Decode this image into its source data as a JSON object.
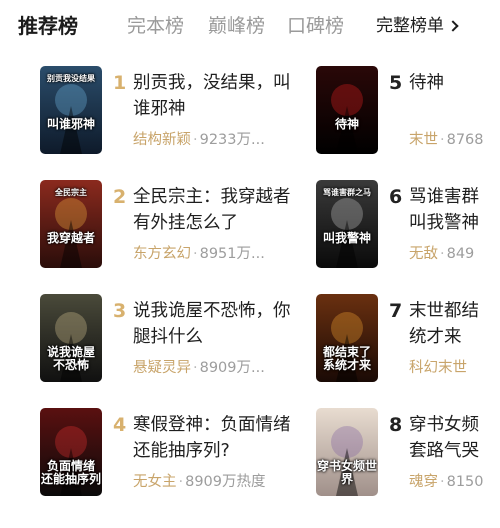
{
  "tabs": [
    "推荐榜",
    "完本榜",
    "巅峰榜",
    "口碑榜"
  ],
  "more_label": "完整榜单",
  "books": [
    {
      "rank": "1",
      "title": "别贡我，没结果，叫谁邪神",
      "category": "结构新颖",
      "heat": "9233万..."
    },
    {
      "rank": "2",
      "title": "全民宗主：我穿越者有外挂怎么了",
      "category": "东方玄幻",
      "heat": "8951万..."
    },
    {
      "rank": "3",
      "title": "说我诡屋不恐怖，你腿抖什么",
      "category": "悬疑灵异",
      "heat": "8909万..."
    },
    {
      "rank": "4",
      "title": "寒假登神：负面情绪还能抽序列?",
      "category": "无女主",
      "heat": "8909万热度"
    },
    {
      "rank": "5",
      "title": "待神",
      "category": "末世",
      "heat": "8768"
    },
    {
      "rank": "6",
      "title": "骂谁害群\n叫我警神",
      "category": "无敌",
      "heat": "849"
    },
    {
      "rank": "7",
      "title": "末世都结\n统才来",
      "category": "科幻末世",
      "heat": ""
    },
    {
      "rank": "8",
      "title": "穿书女频\n套路气哭",
      "category": "魂穿",
      "heat": "8150"
    }
  ],
  "covers": [
    {
      "text": "叫谁邪神",
      "sub": "别贡我没结果",
      "bg1": "#2b4d6b",
      "bg2": "#0e1a2a",
      "accent": "#6fb4e0"
    },
    {
      "text": "我穿越者",
      "sub": "全民宗主",
      "bg1": "#8b2a1e",
      "bg2": "#2a0d0a",
      "accent": "#f0b040"
    },
    {
      "text": "说我诡屋\n不恐怖",
      "sub": "",
      "bg1": "#4a4a3a",
      "bg2": "#101010",
      "accent": "#d0c090"
    },
    {
      "text": "负面情绪\n还能抽序列",
      "sub": "",
      "bg1": "#5a1010",
      "bg2": "#0a0a0a",
      "accent": "#e03030"
    },
    {
      "text": "待神",
      "sub": "",
      "bg1": "#2a0808",
      "bg2": "#000000",
      "accent": "#e02020"
    },
    {
      "text": "叫我警神",
      "sub": "骂谁害群之马",
      "bg1": "#3a3a3a",
      "bg2": "#0a0a0a",
      "accent": "#c0c0c0"
    },
    {
      "text": "都结束了\n系统才来",
      "sub": "",
      "bg1": "#6a3010",
      "bg2": "#1a0a05",
      "accent": "#f0a030"
    },
    {
      "text": "穿书女频世界",
      "sub": "",
      "bg1": "#e8dcd0",
      "bg2": "#a0908a",
      "accent": "#8060a0"
    }
  ]
}
